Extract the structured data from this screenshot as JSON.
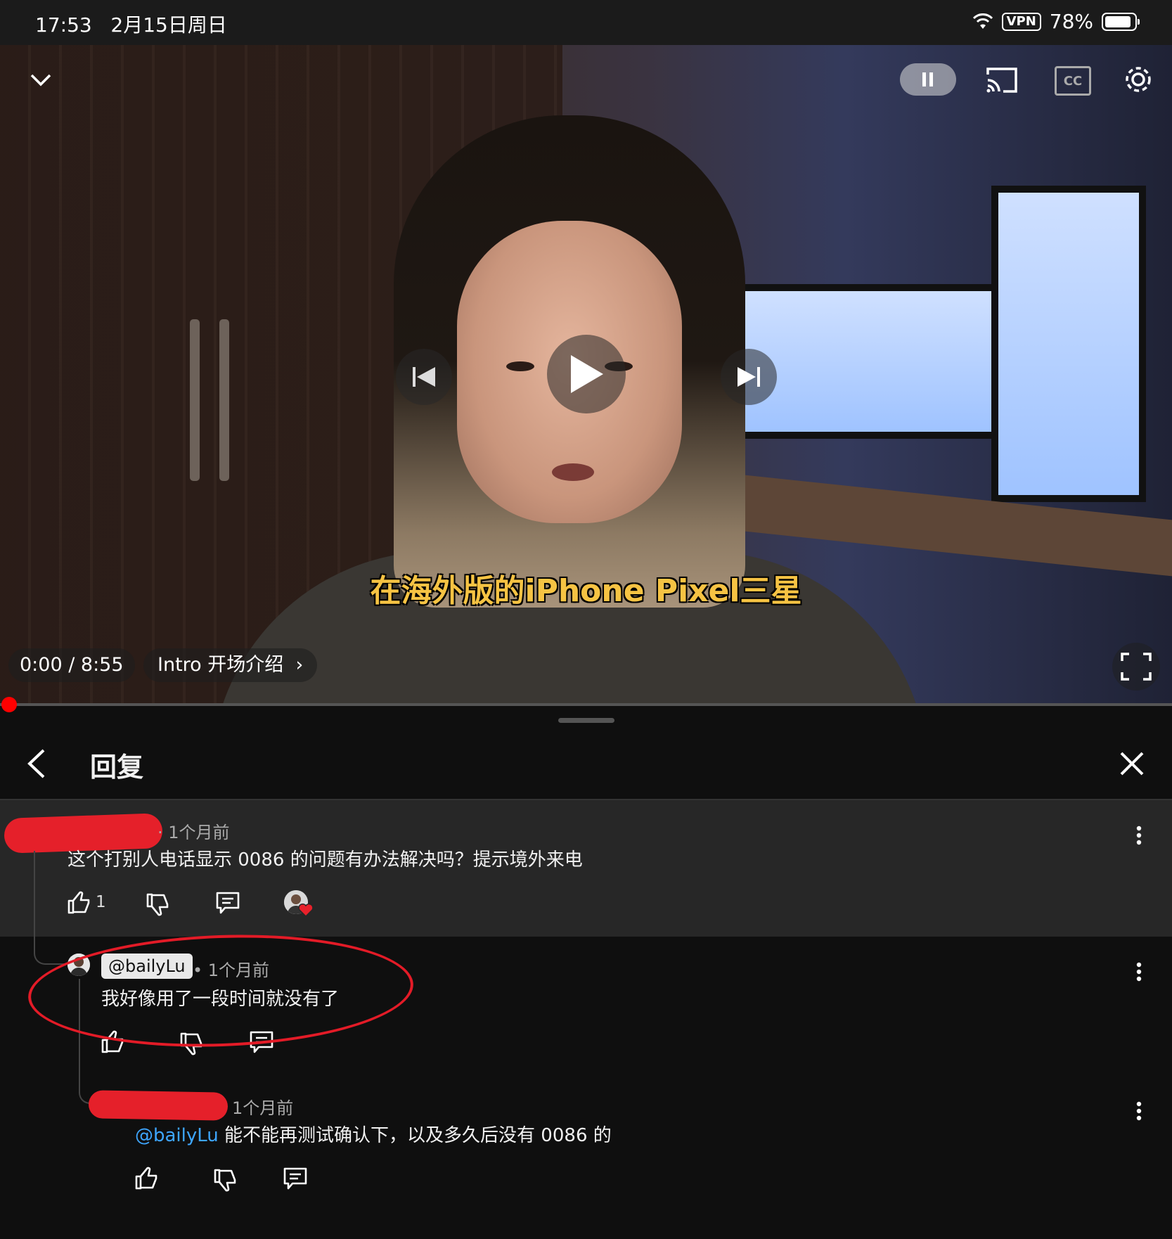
{
  "status_bar": {
    "time": "17:53",
    "date": "2月15日周日",
    "vpn": "VPN",
    "battery": "78%",
    "battery_level": 0.78
  },
  "player": {
    "subtitle": "在海外版的iPhone Pixel三星",
    "time": "0:00 / 8:55",
    "chapter": "Intro 开场介绍",
    "cc_label": "CC",
    "progress": 0.0
  },
  "panel": {
    "title": "回复"
  },
  "comments": {
    "parent": {
      "meta": "· 1个月前",
      "text": "这个打别人电话显示 0086 的问题有办法解决吗？提示境外来电",
      "likes": "1"
    },
    "reply1": {
      "author": "@bailyLu",
      "meta": "• 1个月前",
      "text": "我好像用了一段时间就没有了"
    },
    "reply2": {
      "meta": "1个月前",
      "mention": "@bailyLu",
      "text": "能不能再测试确认下，以及多久后没有 0086 的"
    }
  },
  "icons": {
    "like": "thumbs-up-icon",
    "dislike": "thumbs-down-icon",
    "reply": "comment-icon",
    "more": "kebab-icon",
    "cast": "cast-icon",
    "settings": "gear-icon",
    "back": "chevron-left-icon",
    "close": "close-icon"
  },
  "colors": {
    "accent_red": "#ff0000",
    "mention": "#3ea6ff",
    "annotation": "#e31b27",
    "subtitle": "#f6c343"
  }
}
